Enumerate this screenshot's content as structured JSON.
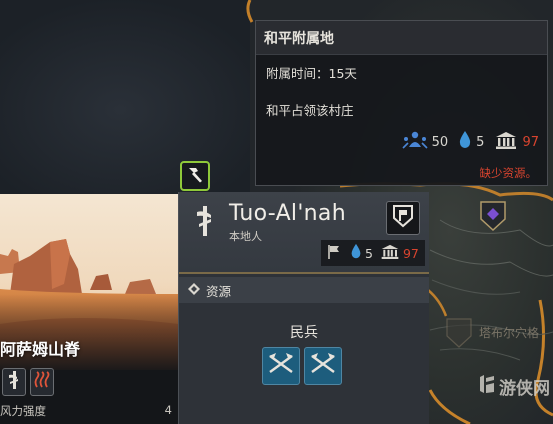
{
  "tooltip": {
    "title": "和平附属地",
    "duration": "附属时间：15天",
    "description": "和平占领该村庄",
    "costs": {
      "influence": "50",
      "water": "5",
      "treasury": "97"
    },
    "warning": "缺少资源。"
  },
  "region": {
    "name": "阿萨姆山脊",
    "stat_label": "风力强度",
    "stat_value": "4"
  },
  "village": {
    "name": "Tuo-Al'nah",
    "subtitle": "本地人",
    "costs": {
      "water": "5",
      "treasury": "97"
    },
    "resources_label": "资源",
    "units_label": "民兵"
  },
  "map": {
    "landmark_name": "塔布尔穴格"
  },
  "watermark": {
    "text": "游侠网"
  },
  "colors": {
    "accent_green": "#8fc93a",
    "warning_red": "#d8442f",
    "unit_blue": "#1d5d7d",
    "influence_blue": "#4a86d6",
    "border_orange": "#e0902a"
  }
}
